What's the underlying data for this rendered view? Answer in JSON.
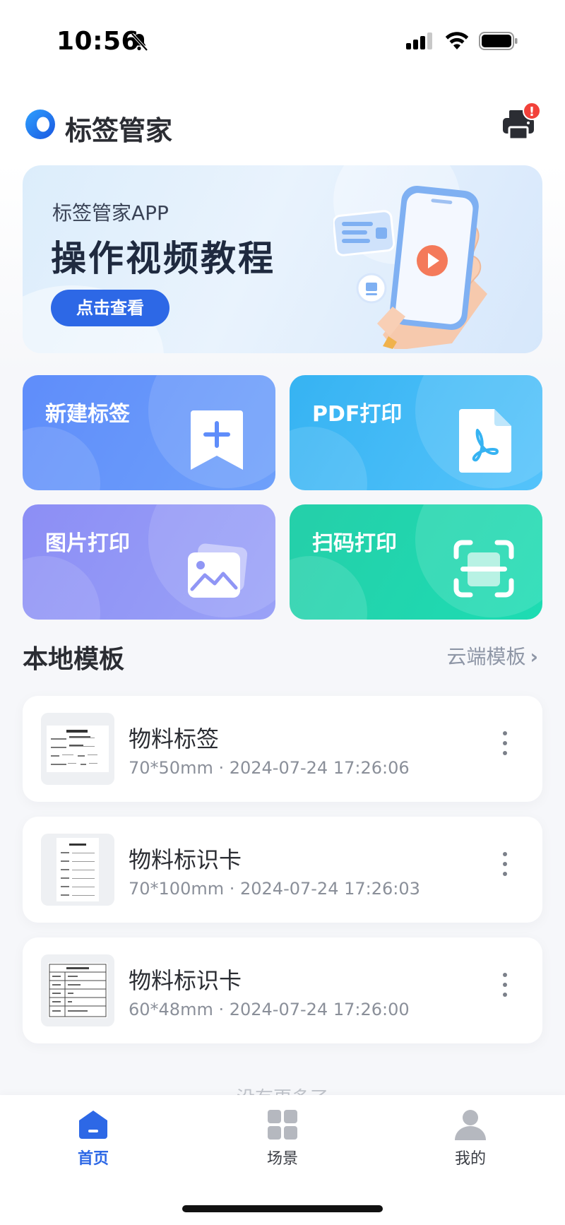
{
  "status_bar": {
    "time": "10:56"
  },
  "header": {
    "app_name": "标签管家",
    "printer_badge": "!"
  },
  "banner": {
    "subtitle": "标签管家APP",
    "title": "操作视频教程",
    "button": "点击查看"
  },
  "actions": [
    {
      "label": "新建标签",
      "icon": "bookmark-plus-icon"
    },
    {
      "label": "PDF打印",
      "icon": "pdf-file-icon"
    },
    {
      "label": "图片打印",
      "icon": "image-icon"
    },
    {
      "label": "扫码打印",
      "icon": "scan-icon"
    }
  ],
  "section": {
    "title": "本地模板",
    "link": "云端模板"
  },
  "templates": [
    {
      "name": "物料标签",
      "meta": "70*50mm · 2024-07-24 17:26:06"
    },
    {
      "name": "物料标识卡",
      "meta": "70*100mm · 2024-07-24 17:26:03"
    },
    {
      "name": "物料标识卡",
      "meta": "60*48mm · 2024-07-24 17:26:00"
    }
  ],
  "list_end_text": "没有更多了",
  "tabbar": {
    "home": "首页",
    "scene": "场景",
    "mine": "我的"
  },
  "colors": {
    "accent": "#2d68e6",
    "new": "#6392fa",
    "pdf": "#3db7f5",
    "image": "#9096f5",
    "scan": "#22d4ad"
  }
}
